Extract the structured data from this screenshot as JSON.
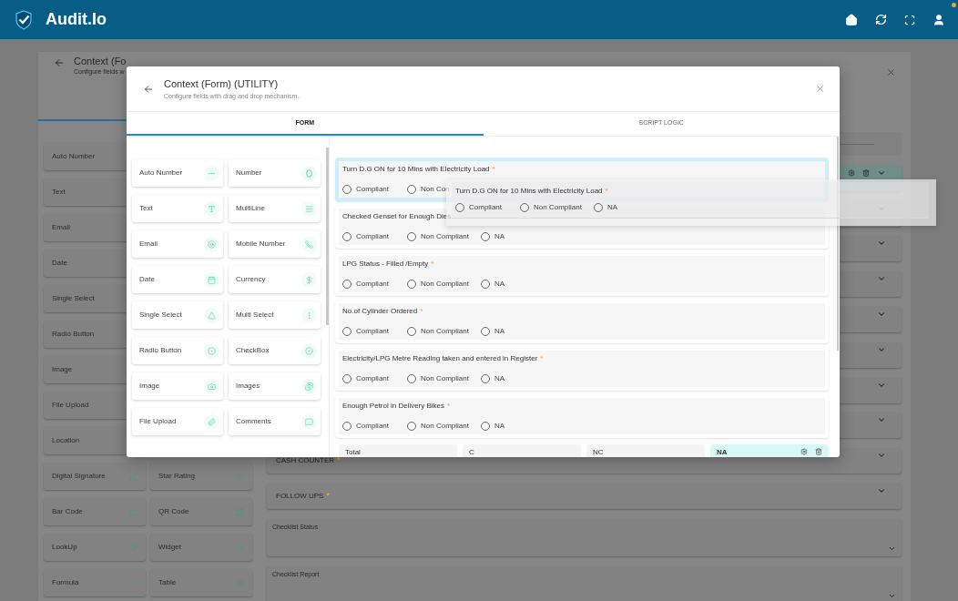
{
  "app": {
    "title": "Audit.Io"
  },
  "page": {
    "title": "Context (Fo",
    "subtitle": "Configure fields w",
    "palette_rows": [
      [
        {
          "label": "Auto Number"
        }
      ],
      [
        {
          "label": "Text"
        }
      ],
      [
        {
          "label": "Email"
        }
      ],
      [
        {
          "label": "Date"
        }
      ],
      [
        {
          "label": "Single Select"
        }
      ],
      [
        {
          "label": "Radio Button"
        }
      ],
      [
        {
          "label": "Image"
        }
      ],
      [
        {
          "label": "File Upload"
        }
      ],
      [
        {
          "label": "Location"
        }
      ],
      [
        {
          "label": "Digital Signature",
          "kind": "signature"
        },
        {
          "label": "Star Rating",
          "kind": "star"
        }
      ],
      [
        {
          "label": "Bar Code",
          "kind": "barcode"
        },
        {
          "label": "QR Code",
          "kind": "qrcode"
        }
      ],
      [
        {
          "label": "LookUp",
          "kind": "lookup"
        },
        {
          "label": "Widget",
          "kind": "lookup"
        }
      ],
      [
        {
          "label": "Formula",
          "kind": "formula"
        },
        {
          "label": "Table",
          "kind": "table"
        }
      ]
    ],
    "sections": [
      {
        "kind": "input"
      },
      {
        "kind": "accordion",
        "highlighted": true
      },
      {
        "kind": "accordion"
      },
      {
        "kind": "accordion",
        "highlighted": false
      },
      {
        "kind": "accordion",
        "highlighted": false
      },
      {
        "kind": "accordion",
        "highlighted": false
      },
      {
        "kind": "accordion",
        "highlighted": false
      },
      {
        "kind": "accordion",
        "highlighted": false
      },
      {
        "kind": "accordion",
        "highlighted": false
      },
      {
        "kind": "accordion",
        "label": "CASH COUNTER",
        "required_mark": "*",
        "highlighted": false
      },
      {
        "kind": "accordion",
        "label": "FOLLOW UPS",
        "required_mark": "*",
        "highlighted": false
      },
      {
        "kind": "select",
        "label": "Checklist Status"
      },
      {
        "kind": "select",
        "label": "Checklist Report"
      }
    ]
  },
  "modal": {
    "title": "Context (Form) (UTILITY)",
    "subtitle": "Configure fields with drag and drop mechanism..",
    "tabs": [
      {
        "label": "FORM",
        "selected": true
      },
      {
        "label": "SCRIPT LOGIC",
        "selected": false
      }
    ],
    "palette": [
      {
        "label": "Auto Number",
        "kind": "auto_number"
      },
      {
        "label": "Number",
        "kind": "number"
      },
      {
        "label": "Text",
        "kind": "text"
      },
      {
        "label": "MultiLine",
        "kind": "multiline"
      },
      {
        "label": "Email",
        "kind": "email"
      },
      {
        "label": "Mobile Number",
        "kind": "phone"
      },
      {
        "label": "Date",
        "kind": "date"
      },
      {
        "label": "Currency",
        "kind": "currency"
      },
      {
        "label": "Single Select",
        "kind": "single_select"
      },
      {
        "label": "Multi Select",
        "kind": "multi_select"
      },
      {
        "label": "Radio Button",
        "kind": "radio"
      },
      {
        "label": "CheckBox",
        "kind": "checkbox"
      },
      {
        "label": "Image",
        "kind": "image"
      },
      {
        "label": "Images",
        "kind": "images"
      },
      {
        "label": "File Upload",
        "kind": "file"
      },
      {
        "label": "Comments",
        "kind": "comments"
      }
    ],
    "questions": [
      {
        "title": "Turn D.G ON for 10 Mins with Electricity Load",
        "required_mark": "*",
        "selected": true,
        "options": [
          {
            "label": "Compliant",
            "selected": false
          },
          {
            "label": "Non Con",
            "selected": false
          }
        ]
      },
      {
        "title": "Checked Genset for Enough Dies",
        "selected": false,
        "options": [
          {
            "label": "Compliant",
            "selected": false
          },
          {
            "label": "Non Compliant",
            "selected": false
          },
          {
            "label": "NA",
            "selected": false
          }
        ]
      },
      {
        "title": "LPG Status - Filled /Empty",
        "required_mark": "*",
        "selected": false,
        "options": [
          {
            "label": "Compliant",
            "selected": false
          },
          {
            "label": "Non Compliant",
            "selected": false
          },
          {
            "label": "NA",
            "selected": false
          }
        ]
      },
      {
        "title": "No.of Cylinder Ordered",
        "required_mark": "*",
        "selected": false,
        "options": [
          {
            "label": "Compliant",
            "selected": false
          },
          {
            "label": "Non Compliant",
            "selected": false
          },
          {
            "label": "NA",
            "selected": false
          }
        ]
      },
      {
        "title": "Electricity/LPG Metre Reading taken and entered in Register",
        "required_mark": "*",
        "selected": false,
        "options": [
          {
            "label": "Compliant",
            "selected": false
          },
          {
            "label": "Non Compliant",
            "selected": false
          },
          {
            "label": "NA",
            "selected": false
          }
        ]
      },
      {
        "title": "Enough Petrol in Delivery Bikes",
        "required_mark": "*",
        "selected": false,
        "options": [
          {
            "label": "Compliant",
            "selected": false
          },
          {
            "label": "Non Compliant",
            "selected": false
          },
          {
            "label": "NA",
            "selected": false
          }
        ]
      }
    ],
    "summary": [
      {
        "label": "Total",
        "highlighted": false
      },
      {
        "label": "C",
        "highlighted": false
      },
      {
        "label": "NC",
        "highlighted": false
      },
      {
        "label": "NA",
        "highlighted": true
      }
    ]
  },
  "drag_ghost": {
    "title": "Turn D.G ON for 10 Mins with Electricity Load",
    "required_mark": "*",
    "options": [
      {
        "label": "Compliant",
        "selected": false
      },
      {
        "label": "Non Compliant",
        "selected": false
      },
      {
        "label": "NA",
        "selected": false
      }
    ]
  }
}
